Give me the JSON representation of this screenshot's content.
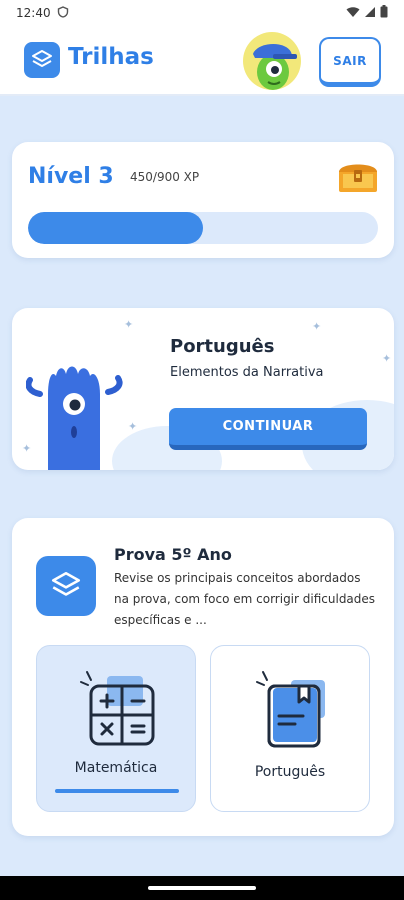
{
  "status_bar": {
    "time": "12:40"
  },
  "header": {
    "app_name": "Trilhas",
    "logout_label": "SAIR"
  },
  "level": {
    "label": "Nível 3",
    "xp_text": "450/900 XP",
    "progress": 0.5
  },
  "continue_card": {
    "subject": "Português",
    "topic": "Elementos da Narrativa",
    "button_label": "CONTINUAR"
  },
  "path": {
    "title": "Prova 5º Ano",
    "description": "Revise os principais conceitos abordados na prova, com foco em corrigir dificuldades específicas e ...",
    "subjects": [
      {
        "label": "Matemática",
        "icon": "calculator-icon",
        "selected": true
      },
      {
        "label": "Português",
        "icon": "book-icon",
        "selected": false
      }
    ]
  },
  "colors": {
    "accent": "#3d8ae9",
    "background": "#dbe9fb"
  }
}
